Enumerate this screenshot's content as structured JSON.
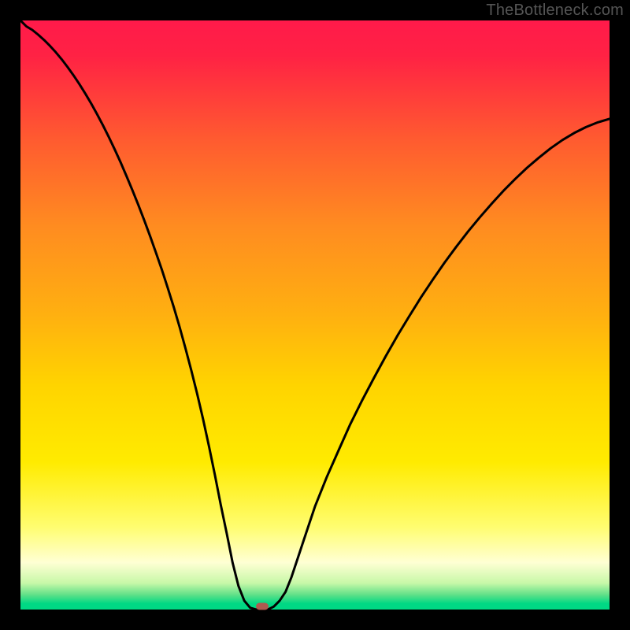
{
  "watermark": {
    "text": "TheBottleneck.com"
  },
  "chart_data": {
    "type": "line",
    "title": "",
    "xlabel": "",
    "ylabel": "",
    "xlim": [
      0,
      100
    ],
    "ylim": [
      0,
      100
    ],
    "x": [
      0,
      1,
      2,
      3,
      4,
      5,
      6,
      7,
      8,
      9,
      10,
      11,
      12,
      13,
      14,
      15,
      16,
      17,
      18,
      19,
      20,
      21,
      22,
      23,
      24,
      25,
      26,
      27,
      28,
      29,
      30,
      31,
      32,
      33,
      34,
      35,
      36,
      37,
      38,
      39,
      40,
      41,
      42,
      43,
      44,
      45,
      46,
      47,
      48,
      49,
      50,
      52,
      54,
      56,
      58,
      60,
      62,
      64,
      66,
      68,
      70,
      72,
      74,
      76,
      78,
      80,
      82,
      84,
      86,
      88,
      90,
      92,
      94,
      96,
      98,
      100
    ],
    "values": [
      100,
      99,
      98.4,
      97.6,
      96.7,
      95.7,
      94.6,
      93.4,
      92.1,
      90.7,
      89.2,
      87.6,
      85.9,
      84.1,
      82.2,
      80.2,
      78.1,
      75.9,
      73.6,
      71.2,
      68.7,
      66.1,
      63.4,
      60.6,
      57.7,
      54.6,
      51.4,
      48.0,
      44.4,
      40.6,
      36.6,
      32.3,
      27.7,
      22.9,
      17.8,
      13.0,
      8.0,
      4.0,
      1.5,
      0.3,
      0,
      0,
      0,
      0.5,
      1.5,
      3.0,
      5.5,
      8.5,
      11.5,
      14.5,
      17.5,
      22.5,
      27.0,
      31.5,
      35.5,
      39.3,
      43.0,
      46.5,
      49.8,
      53.0,
      56.0,
      58.9,
      61.6,
      64.2,
      66.6,
      68.9,
      71.1,
      73.1,
      75.0,
      76.7,
      78.3,
      79.7,
      80.9,
      81.9,
      82.7,
      83.3
    ],
    "gradient": {
      "stops": [
        {
          "offset": 0.0,
          "color": "#ff1a4a"
        },
        {
          "offset": 0.06,
          "color": "#ff2244"
        },
        {
          "offset": 0.2,
          "color": "#ff5a30"
        },
        {
          "offset": 0.35,
          "color": "#ff8c20"
        },
        {
          "offset": 0.5,
          "color": "#ffb010"
        },
        {
          "offset": 0.62,
          "color": "#ffd400"
        },
        {
          "offset": 0.75,
          "color": "#ffeb00"
        },
        {
          "offset": 0.86,
          "color": "#fffd70"
        },
        {
          "offset": 0.92,
          "color": "#ffffd4"
        },
        {
          "offset": 0.955,
          "color": "#c8f8a8"
        },
        {
          "offset": 0.975,
          "color": "#60e088"
        },
        {
          "offset": 0.99,
          "color": "#00d884"
        },
        {
          "offset": 1.0,
          "color": "#00d884"
        }
      ]
    },
    "marker": {
      "x_pct": 41.0,
      "y_pct": 0.5,
      "color": "#b05a50"
    },
    "curve_stroke": "#000000",
    "curve_width": 3
  }
}
